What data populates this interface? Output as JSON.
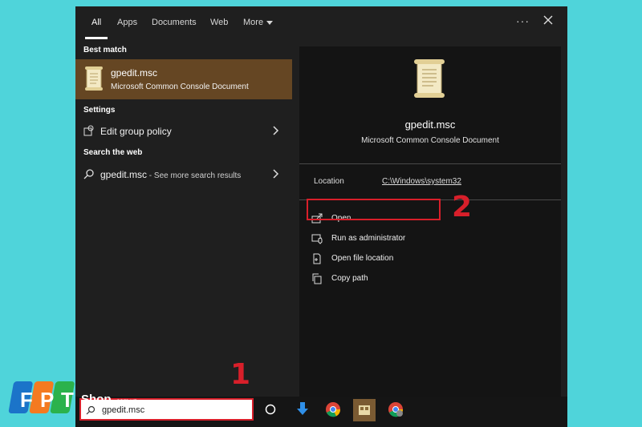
{
  "tabs": [
    "All",
    "Apps",
    "Documents",
    "Web",
    "More"
  ],
  "left": {
    "best_match_heading": "Best match",
    "best": {
      "title": "gpedit.msc",
      "subtitle": "Microsoft Common Console Document"
    },
    "settings_heading": "Settings",
    "settings_item": "Edit group policy",
    "web_heading": "Search the web",
    "web_query": "gpedit.msc",
    "web_suffix": " - See more search results"
  },
  "right": {
    "title": "gpedit.msc",
    "subtitle": "Microsoft Common Console Document",
    "location_label": "Location",
    "location_value": "C:\\Windows\\system32",
    "actions": [
      "Open",
      "Run as administrator",
      "Open file location",
      "Copy path"
    ]
  },
  "taskbar": {
    "search_value": "gpedit.msc"
  },
  "annotations": {
    "step1": "1",
    "step2": "2"
  },
  "logo": {
    "brand": "FPT",
    "shop": "Shop",
    "domain": ".com.vn"
  },
  "colors": {
    "accent_selection": "#654623",
    "annotation_red": "#d81f2a",
    "background": "#4fd4da"
  }
}
